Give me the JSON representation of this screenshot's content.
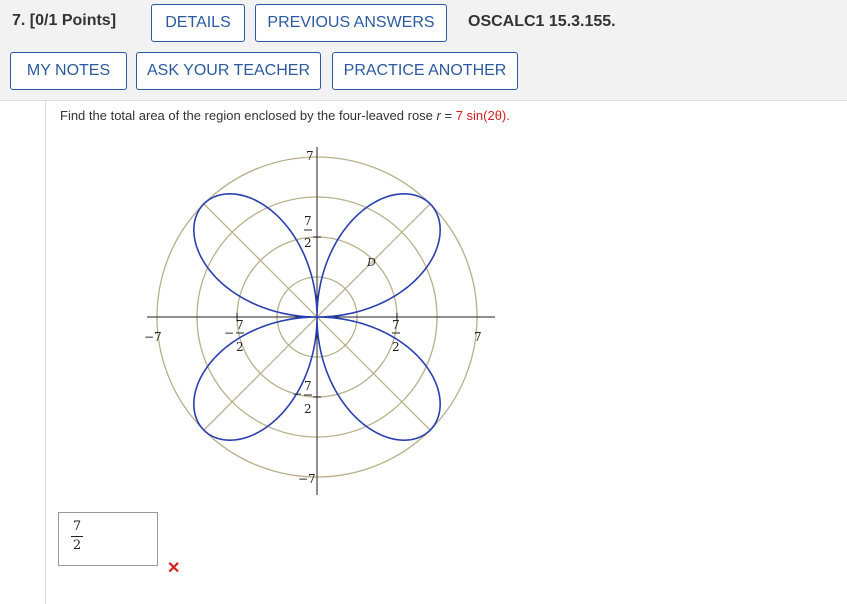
{
  "header": {
    "question_number": "7.",
    "points": "[0/1 Points]",
    "details_label": "DETAILS",
    "previous_answers_label": "PREVIOUS ANSWERS",
    "problem_code": "OSCALC1 15.3.155.",
    "my_notes_label": "MY NOTES",
    "ask_teacher_label": "ASK YOUR TEACHER",
    "practice_another_label": "PRACTICE ANOTHER"
  },
  "question": {
    "text_before": "Find the total area of the region enclosed by the four-leaved rose ",
    "r_var": "r",
    "equals": " = ",
    "expression": "7 sin(2θ).",
    "region_label": "D"
  },
  "plot_labels": {
    "top": "7",
    "bottom": "−7",
    "left": "−7",
    "right": "7",
    "half_num": "7",
    "half_den": "2",
    "neg_sign": "−"
  },
  "answer": {
    "numerator": "7",
    "denominator": "2",
    "status_icon": "wrong-x-icon"
  },
  "colors": {
    "accent": "#2c5aa0",
    "rose_curve": "#2a3fb0",
    "grid": "#b8b08a",
    "error": "#d42020"
  }
}
